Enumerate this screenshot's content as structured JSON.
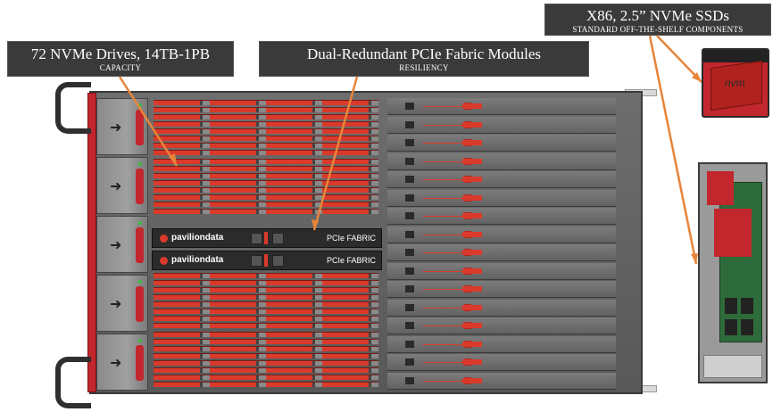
{
  "callouts": {
    "capacity": {
      "title": "72 NVMe Drives, 14TB-1PB",
      "subtitle": "CAPACITY"
    },
    "resiliency": {
      "title": "Dual-Redundant PCIe Fabric Modules",
      "subtitle": "RESILIENCY"
    },
    "components": {
      "title": "X86, 2.5” NVMe SSDs",
      "subtitle": "STANDARD OFF-THE-SHELF COMPONENTS"
    }
  },
  "fabric_modules": [
    {
      "brand": "pavilion",
      "brand_bold": "data",
      "label": "PCIe FABRIC"
    },
    {
      "brand": "pavilion",
      "brand_bold": "data",
      "label": "PCIe FABRIC"
    }
  ],
  "ssd_label": "nvm",
  "sled_icon": "arrow-right-icon",
  "colors": {
    "accent": "#d93a2b",
    "callout_bg": "#3a3a3a",
    "chassis": "#626262"
  }
}
